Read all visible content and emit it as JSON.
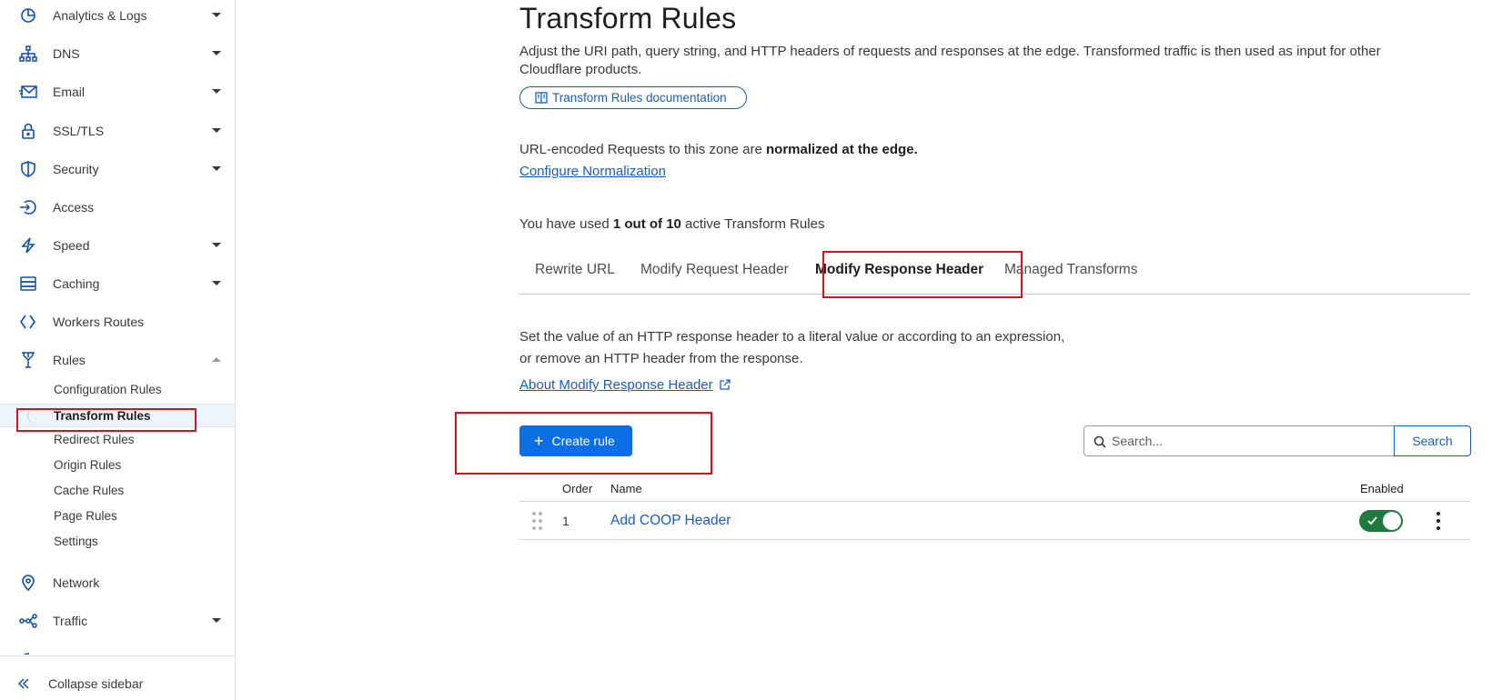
{
  "sidebar": {
    "items": [
      {
        "label": "Analytics & Logs",
        "icon": "analytics-icon"
      },
      {
        "label": "DNS",
        "icon": "dns-icon"
      },
      {
        "label": "Email",
        "icon": "email-icon"
      },
      {
        "label": "SSL/TLS",
        "icon": "lock-icon"
      },
      {
        "label": "Security",
        "icon": "shield-icon"
      },
      {
        "label": "Access",
        "icon": "access-icon"
      },
      {
        "label": "Speed",
        "icon": "lightning-icon"
      },
      {
        "label": "Caching",
        "icon": "caching-icon"
      },
      {
        "label": "Workers Routes",
        "icon": "workers-icon"
      },
      {
        "label": "Rules",
        "icon": "rules-icon"
      },
      {
        "label": "Network",
        "icon": "location-pin-icon"
      },
      {
        "label": "Traffic",
        "icon": "traffic-icon"
      }
    ],
    "rules_subitems": [
      {
        "label": "Configuration Rules"
      },
      {
        "label": "Transform Rules"
      },
      {
        "label": "Redirect Rules"
      },
      {
        "label": "Origin Rules"
      },
      {
        "label": "Cache Rules"
      },
      {
        "label": "Page Rules"
      },
      {
        "label": "Settings"
      }
    ],
    "collapse_label": "Collapse sidebar"
  },
  "page": {
    "title": "Transform Rules",
    "description": "Adjust the URI path, query string, and HTTP headers of requests and responses at the edge. Transformed traffic is then used as input for other Cloudflare products.",
    "doc_link": "Transform Rules documentation",
    "normalization_prefix": "URL-encoded Requests to this zone are ",
    "normalization_bold": "normalized at the edge.",
    "normalization_link": "Configure Normalization",
    "usage_prefix": "You have used ",
    "usage_bold": "1 out of 10",
    "usage_suffix": " active Transform Rules"
  },
  "tabs": [
    {
      "label": "Rewrite URL"
    },
    {
      "label": "Modify Request Header"
    },
    {
      "label": "Modify Response Header"
    },
    {
      "label": "Managed Transforms"
    }
  ],
  "section": {
    "desc_line1": "Set the value of an HTTP response header to a literal value or according to an expression,",
    "desc_line2": "or remove an HTTP header from the response.",
    "about_link": "About Modify Response Header",
    "create_button": "Create rule",
    "search_placeholder": "Search...",
    "search_button": "Search"
  },
  "table": {
    "headers": {
      "order": "Order",
      "name": "Name",
      "enabled": "Enabled"
    },
    "rows": [
      {
        "order": "1",
        "name": "Add COOP Header",
        "enabled": true
      }
    ]
  },
  "colors": {
    "link": "#1a5fb4",
    "primary_button": "#0a6fe5",
    "toggle_on": "#1f7a3d",
    "highlight_box": "#d3131d"
  }
}
